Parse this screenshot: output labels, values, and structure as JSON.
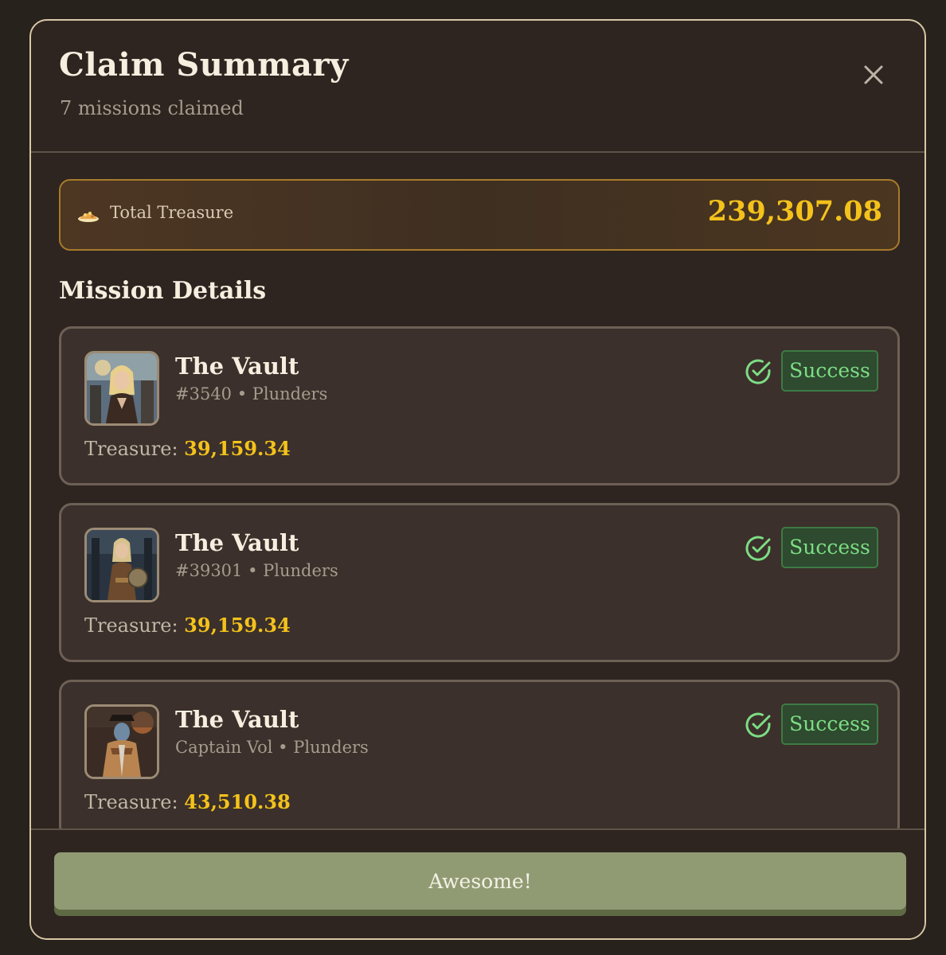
{
  "header": {
    "title": "Claim Summary",
    "subtitle": "7 missions claimed",
    "close_icon": "close-icon"
  },
  "summary": {
    "label": "Total Treasure",
    "value": "239,307.08",
    "icon": "treasure-pile-icon"
  },
  "section_title": "Mission Details",
  "missions": [
    {
      "name": "The Vault",
      "meta": "#3540 • Plunders",
      "status": "Success",
      "treasure_label": "Treasure:",
      "treasure_value": "39,159.34",
      "avatar_icon": "pirate-portrait-blonde"
    },
    {
      "name": "The Vault",
      "meta": "#39301 • Plunders",
      "status": "Success",
      "treasure_label": "Treasure:",
      "treasure_value": "39,159.34",
      "avatar_icon": "pirate-portrait-warrior"
    },
    {
      "name": "The Vault",
      "meta": "Captain Vol • Plunders",
      "status": "Success",
      "treasure_label": "Treasure:",
      "treasure_value": "43,510.38",
      "avatar_icon": "pirate-portrait-captain"
    }
  ],
  "footer": {
    "button_label": "Awesome!"
  },
  "colors": {
    "accent_gold": "#f4c21b",
    "success_green": "#7ddd84",
    "button_green": "#919b73",
    "panel_border": "#d8c7a6"
  }
}
